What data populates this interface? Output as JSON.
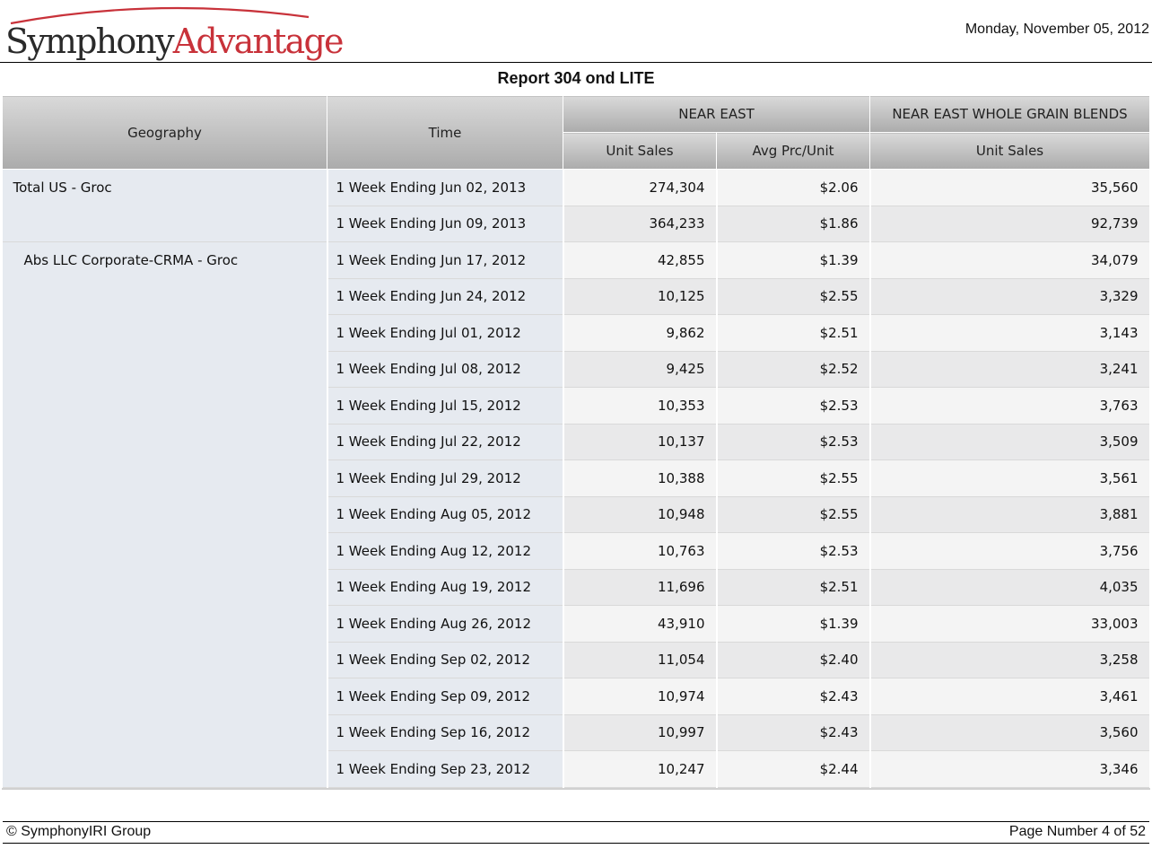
{
  "header": {
    "logo_part1": "Symphony",
    "logo_part2": "Advantage",
    "date": "Monday, November 05, 2012"
  },
  "report_title": "Report 304 ond LITE",
  "columns": {
    "geography": "Geography",
    "time": "Time",
    "group1": "NEAR EAST",
    "group2": "NEAR EAST WHOLE GRAIN BLENDS",
    "unit_sales": "Unit Sales",
    "avg_price": "Avg Prc/Unit",
    "unit_sales2": "Unit Sales"
  },
  "rows": [
    {
      "geo": "Total US - Groc",
      "time": "1 Week Ending Jun 02, 2013",
      "unit_sales": "274,304",
      "avg_price": "$2.06",
      "wgb_unit_sales": "35,560"
    },
    {
      "geo": "",
      "time": "1 Week Ending Jun 09, 2013",
      "unit_sales": "364,233",
      "avg_price": "$1.86",
      "wgb_unit_sales": "92,739"
    },
    {
      "geo": "Abs LLC Corporate-CRMA - Groc",
      "time": "1 Week Ending Jun 17, 2012",
      "unit_sales": "42,855",
      "avg_price": "$1.39",
      "wgb_unit_sales": "34,079"
    },
    {
      "geo": "",
      "time": "1 Week Ending Jun 24, 2012",
      "unit_sales": "10,125",
      "avg_price": "$2.55",
      "wgb_unit_sales": "3,329"
    },
    {
      "geo": "",
      "time": "1 Week Ending Jul 01, 2012",
      "unit_sales": "9,862",
      "avg_price": "$2.51",
      "wgb_unit_sales": "3,143"
    },
    {
      "geo": "",
      "time": "1 Week Ending Jul 08, 2012",
      "unit_sales": "9,425",
      "avg_price": "$2.52",
      "wgb_unit_sales": "3,241"
    },
    {
      "geo": "",
      "time": "1 Week Ending Jul 15, 2012",
      "unit_sales": "10,353",
      "avg_price": "$2.53",
      "wgb_unit_sales": "3,763"
    },
    {
      "geo": "",
      "time": "1 Week Ending Jul 22, 2012",
      "unit_sales": "10,137",
      "avg_price": "$2.53",
      "wgb_unit_sales": "3,509"
    },
    {
      "geo": "",
      "time": "1 Week Ending Jul 29, 2012",
      "unit_sales": "10,388",
      "avg_price": "$2.55",
      "wgb_unit_sales": "3,561"
    },
    {
      "geo": "",
      "time": "1 Week Ending Aug 05, 2012",
      "unit_sales": "10,948",
      "avg_price": "$2.55",
      "wgb_unit_sales": "3,881"
    },
    {
      "geo": "",
      "time": "1 Week Ending Aug 12, 2012",
      "unit_sales": "10,763",
      "avg_price": "$2.53",
      "wgb_unit_sales": "3,756"
    },
    {
      "geo": "",
      "time": "1 Week Ending Aug 19, 2012",
      "unit_sales": "11,696",
      "avg_price": "$2.51",
      "wgb_unit_sales": "4,035"
    },
    {
      "geo": "",
      "time": "1 Week Ending Aug 26, 2012",
      "unit_sales": "43,910",
      "avg_price": "$1.39",
      "wgb_unit_sales": "33,003"
    },
    {
      "geo": "",
      "time": "1 Week Ending Sep 02, 2012",
      "unit_sales": "11,054",
      "avg_price": "$2.40",
      "wgb_unit_sales": "3,258"
    },
    {
      "geo": "",
      "time": "1 Week Ending Sep 09, 2012",
      "unit_sales": "10,974",
      "avg_price": "$2.43",
      "wgb_unit_sales": "3,461"
    },
    {
      "geo": "",
      "time": "1 Week Ending Sep 16, 2012",
      "unit_sales": "10,997",
      "avg_price": "$2.43",
      "wgb_unit_sales": "3,560"
    },
    {
      "geo": "",
      "time": "1 Week Ending Sep 23, 2012",
      "unit_sales": "10,247",
      "avg_price": "$2.44",
      "wgb_unit_sales": "3,346"
    }
  ],
  "footer": {
    "copyright": "© SymphonyIRI Group",
    "page": "Page Number 4 of 52"
  },
  "colors": {
    "brand_red": "#c8323a",
    "brand_dark": "#2a2a2a",
    "header_bg": "#bdbdbd",
    "geo_bg": "#e6eaf0"
  }
}
